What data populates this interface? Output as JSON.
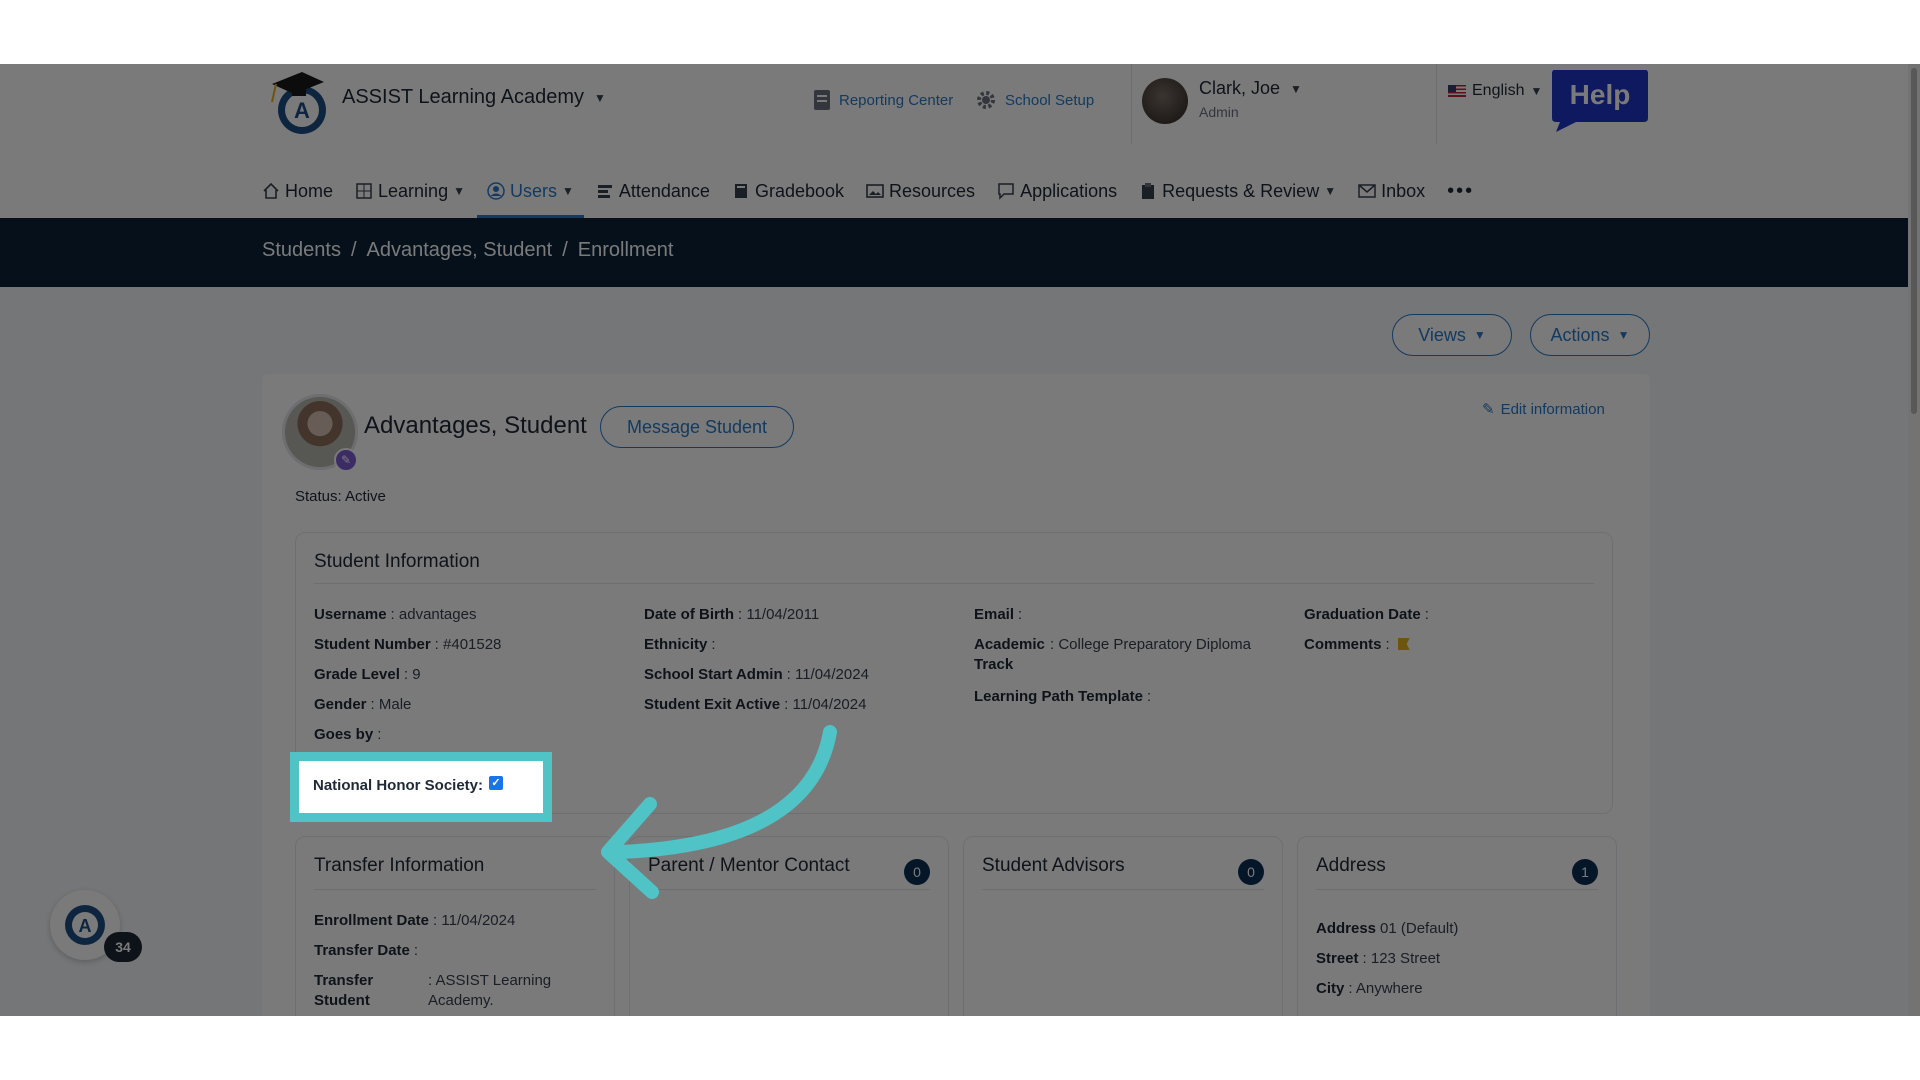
{
  "header": {
    "school_name": "ASSIST Learning Academy",
    "reporting_center": "Reporting Center",
    "school_setup": "School Setup",
    "user_name": "Clark, Joe",
    "user_role": "Admin",
    "language": "English",
    "help_label": "Help"
  },
  "nav": {
    "items": [
      {
        "label": "Home",
        "icon": "home-icon"
      },
      {
        "label": "Learning",
        "icon": "grid-icon"
      },
      {
        "label": "Users",
        "icon": "user-icon"
      },
      {
        "label": "Attendance",
        "icon": "list-icon"
      },
      {
        "label": "Gradebook",
        "icon": "book-icon"
      },
      {
        "label": "Resources",
        "icon": "image-icon"
      },
      {
        "label": "Applications",
        "icon": "comment-icon"
      },
      {
        "label": "Requests & Review",
        "icon": "clipboard-icon"
      },
      {
        "label": "Inbox",
        "icon": "mail-icon"
      }
    ],
    "more": "•••"
  },
  "breadcrumb": {
    "items": [
      "Students",
      "Advantages, Student",
      "Enrollment"
    ],
    "sep": "/"
  },
  "toolbar": {
    "views": "Views",
    "actions": "Actions"
  },
  "student": {
    "name": "Advantages, Student",
    "message_button": "Message Student",
    "edit_link": "Edit information",
    "status": "Status: Active"
  },
  "student_info": {
    "title": "Student Information",
    "col1": [
      {
        "k": "Username",
        "v": ": advantages"
      },
      {
        "k": "Student Number",
        "v": ": #401528"
      },
      {
        "k": "Grade Level",
        "v": ": 9"
      },
      {
        "k": "Gender",
        "v": ": Male"
      },
      {
        "k": "Goes by",
        "v": ":"
      }
    ],
    "col2": [
      {
        "k": "Date of Birth",
        "v": ": 11/04/2011"
      },
      {
        "k": "Ethnicity",
        "v": ":"
      },
      {
        "k": "School Start Admin",
        "v": ": 11/04/2024"
      },
      {
        "k": "Student Exit Active",
        "v": ": 11/04/2024"
      }
    ],
    "col3": [
      {
        "k": "Email",
        "v": ":"
      },
      {
        "k": "Academic Track",
        "v": ": College Preparatory Diploma"
      },
      {
        "k": "Learning Path Template",
        "v": ":"
      }
    ],
    "col4": [
      {
        "k": "Graduation Date",
        "v": ":"
      },
      {
        "k": "Comments",
        "v": ":"
      }
    ],
    "nhs_label": "National Honor Society:",
    "nhs_checked": true
  },
  "cards": {
    "transfer": {
      "title": "Transfer Information",
      "rows": [
        {
          "k": "Enrollment Date",
          "v": ": 11/04/2024"
        },
        {
          "k": "Transfer Date",
          "v": ":"
        },
        {
          "k": "Transfer Student",
          "v": ": ASSIST Learning Academy."
        }
      ]
    },
    "parent": {
      "title": "Parent / Mentor Contact",
      "count": "0"
    },
    "advisors": {
      "title": "Student Advisors",
      "count": "0"
    },
    "address": {
      "title": "Address",
      "count": "1",
      "rows": [
        {
          "k": "Address",
          "v": " 01 (Default)"
        },
        {
          "k": "Street",
          "v": ": 123 Street"
        },
        {
          "k": "City",
          "v": ": Anywhere"
        }
      ]
    }
  },
  "floating": {
    "count": "34"
  },
  "colors": {
    "accent": "#2a7ac8",
    "navy": "#0c2338",
    "highlight": "#4fc3c6"
  }
}
